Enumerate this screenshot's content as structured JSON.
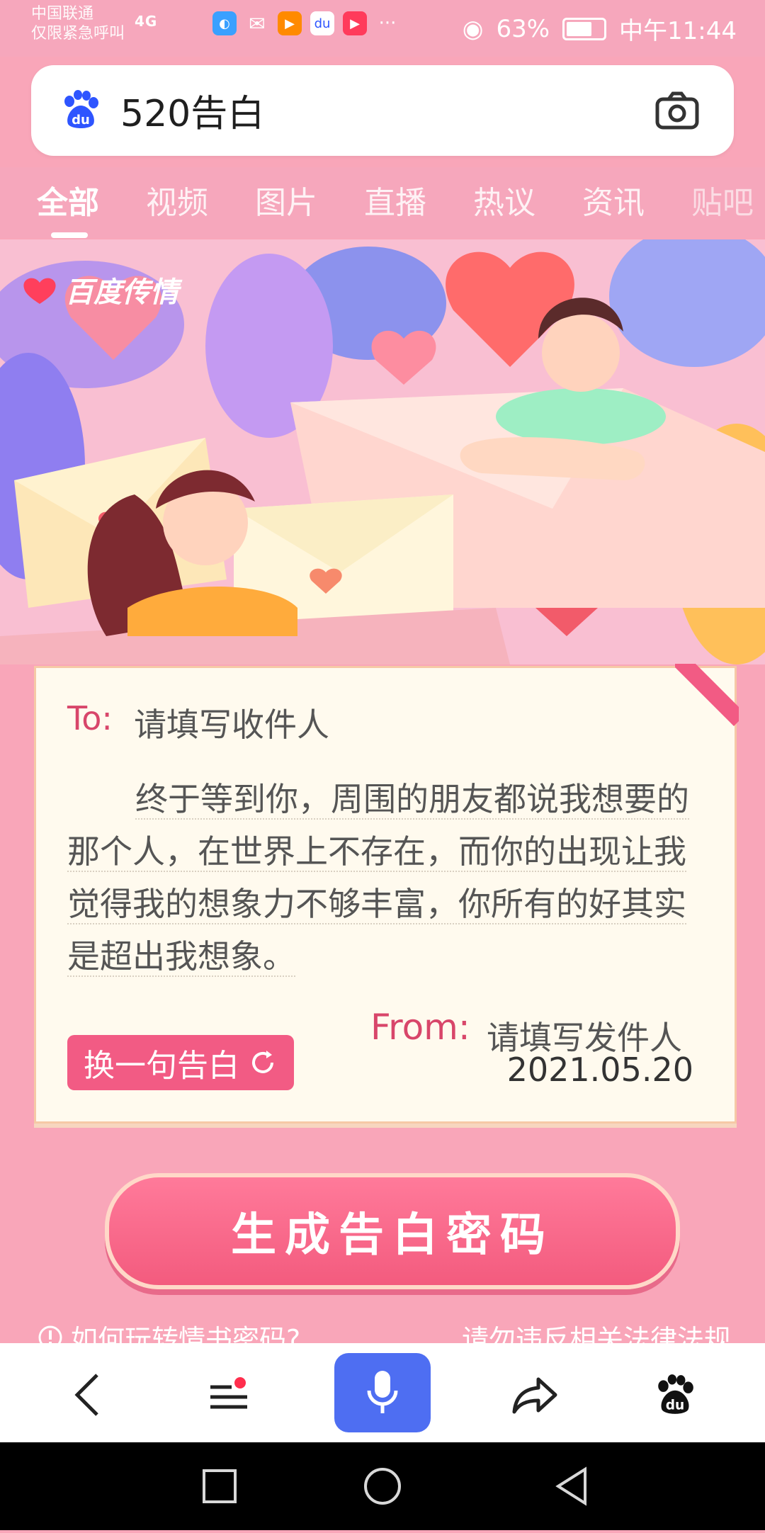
{
  "status_bar": {
    "carrier_line1": "中国联通",
    "carrier_line2": "仅限紧急呼叫",
    "signal": "4G",
    "battery": "63%",
    "time": "中午11:44"
  },
  "search": {
    "query": "520告白"
  },
  "tabs": [
    {
      "label": "全部",
      "active": true
    },
    {
      "label": "视频"
    },
    {
      "label": "图片"
    },
    {
      "label": "直播"
    },
    {
      "label": "热议"
    },
    {
      "label": "资讯"
    },
    {
      "label": "贴吧"
    }
  ],
  "banner": {
    "brand": "百度传情"
  },
  "letter": {
    "to_label": "To:",
    "to_placeholder": "请填写收件人",
    "message": "终于等到你，周围的朋友都说我想要的那个人，在世界上不存在，而你的出现让我觉得我的想象力不够丰富，你所有的好其实是超出我想象。",
    "switch_button": "换一句告白",
    "from_label": "From:",
    "from_placeholder": "请填写发件人",
    "date": "2021.05.20"
  },
  "generate_button": "生成告白密码",
  "links": {
    "help": "如何玩转情书密码?",
    "notice": "请勿违反相关法律法规"
  },
  "colors": {
    "accent": "#f25b84",
    "brand_blue": "#4e6ef2"
  }
}
